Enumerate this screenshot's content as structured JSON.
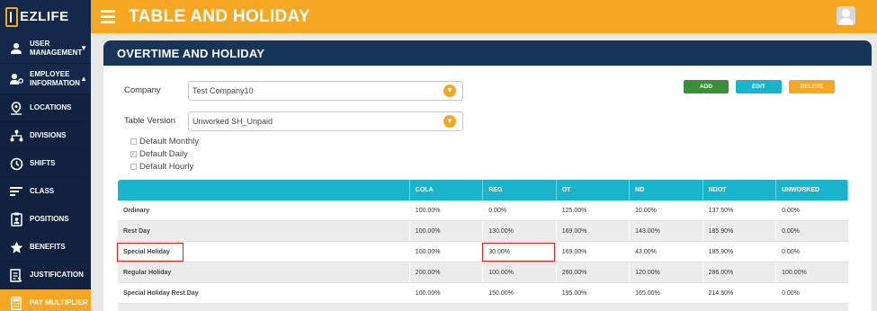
{
  "app": {
    "logo_text": "EZLIFE"
  },
  "header": {
    "title": "TABLE AND HOLIDAY"
  },
  "sidebar": {
    "items": [
      {
        "label": "USER MANAGEMENT",
        "icon": "user-icon",
        "caret": "▼"
      },
      {
        "label": "EMPLOYEE INFORMATION",
        "icon": "employee-icon",
        "caret": "▲"
      },
      {
        "label": "LOCATIONS",
        "icon": "location-pin-icon"
      },
      {
        "label": "DIVISIONS",
        "icon": "hierarchy-icon"
      },
      {
        "label": "SHIFTS",
        "icon": "clock-icon"
      },
      {
        "label": "CLASS",
        "icon": "lines-icon"
      },
      {
        "label": "POSITIONS",
        "icon": "badge-icon"
      },
      {
        "label": "BENEFITS",
        "icon": "star-icon"
      },
      {
        "label": "JUSTIFICATION",
        "icon": "document-icon"
      },
      {
        "label": "PAY MULTIPLIER",
        "icon": "calculator-icon"
      }
    ],
    "active": "PAY MULTIPLIER"
  },
  "card": {
    "title": "OVERTIME AND HOLIDAY"
  },
  "form": {
    "company_label": "Company",
    "company_value": "Test Company10",
    "table_version_label": "Table Version",
    "table_version_value": "Unworked SH_Unpaid",
    "checkboxes": [
      {
        "label": "Default Monthly",
        "checked": false
      },
      {
        "label": "Default Daily",
        "checked": true
      },
      {
        "label": "Default Hourly",
        "checked": false
      }
    ]
  },
  "actions": {
    "add": "ADD",
    "edit": "EDIT",
    "delete": "DELETE"
  },
  "colors": {
    "accent": "#f5a623",
    "sidebar": "#13284a",
    "table_header": "#1ab3cc",
    "add": "#3a8f3a",
    "highlight": "#e02020"
  },
  "table": {
    "columns": [
      "",
      "COLA",
      "REG",
      "OT",
      "ND",
      "NDOT",
      "UNWORKED"
    ],
    "rows": [
      [
        "Ordinary",
        "100.00%",
        "0.00%",
        "125.00%",
        "10.00%",
        "137.50%",
        "0.00%"
      ],
      [
        "Rest Day",
        "100.00%",
        "130.00%",
        "169.00%",
        "143.00%",
        "185.90%",
        "0.00%"
      ],
      [
        "Special Holiday",
        "100.00%",
        "30.00%",
        "169.00%",
        "43.00%",
        "185.90%",
        "0.00%"
      ],
      [
        "Regular Holiday",
        "200.00%",
        "100.00%",
        "260.00%",
        "120.00%",
        "286.00%",
        "100.00%"
      ],
      [
        "Special Holiday Rest Day",
        "100.00%",
        "150.00%",
        "195.00%",
        "165.00%",
        "214.50%",
        "0.00%"
      ]
    ],
    "highlighted_cells": [
      "Special Holiday",
      "30.00%"
    ]
  }
}
